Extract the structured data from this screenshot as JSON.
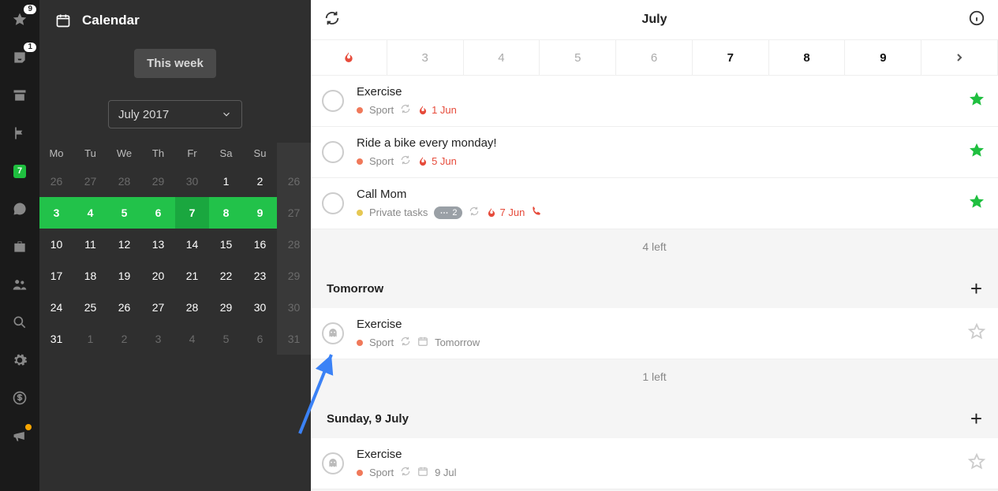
{
  "rail": {
    "star_badge": "9",
    "inbox_badge": "1",
    "today_date": "7"
  },
  "side": {
    "title": "Calendar",
    "this_week": "This week",
    "month_label": "July 2017",
    "weekdays": [
      "Mo",
      "Tu",
      "We",
      "Th",
      "Fr",
      "Sa",
      "Su"
    ],
    "grid": [
      [
        "26",
        "27",
        "28",
        "29",
        "30",
        "1",
        "2",
        "26"
      ],
      [
        "3",
        "4",
        "5",
        "6",
        "7",
        "8",
        "9",
        "27"
      ],
      [
        "10",
        "11",
        "12",
        "13",
        "14",
        "15",
        "16",
        "28"
      ],
      [
        "17",
        "18",
        "19",
        "20",
        "21",
        "22",
        "23",
        "29"
      ],
      [
        "24",
        "25",
        "26",
        "27",
        "28",
        "29",
        "30",
        "30"
      ],
      [
        "31",
        "1",
        "2",
        "3",
        "4",
        "5",
        "6",
        "31"
      ]
    ]
  },
  "top": {
    "month": "July"
  },
  "strip": {
    "days": [
      "3",
      "4",
      "5",
      "6",
      "7",
      "8",
      "9"
    ]
  },
  "sections": [
    {
      "tasks": [
        {
          "title": "Exercise",
          "category": "Sport",
          "cat_color": "sport",
          "repeat": true,
          "overdue": "1 Jun",
          "starred": true
        },
        {
          "title": "Ride a bike every monday!",
          "category": "Sport",
          "cat_color": "sport",
          "repeat": true,
          "overdue": "5 Jun",
          "starred": true
        },
        {
          "title": "Call Mom",
          "category": "Private tasks",
          "cat_color": "private",
          "repeat": true,
          "overdue": "7 Jun",
          "comments": "2",
          "phone": true,
          "starred": true
        }
      ],
      "footer": "4 left"
    },
    {
      "header": "Tomorrow",
      "tasks": [
        {
          "title": "Exercise",
          "category": "Sport",
          "cat_color": "sport",
          "repeat": true,
          "date_label": "Tomorrow",
          "ghost": true,
          "starred": false
        }
      ],
      "footer": "1 left"
    },
    {
      "header": "Sunday, 9 July",
      "tasks": [
        {
          "title": "Exercise",
          "category": "Sport",
          "cat_color": "sport",
          "repeat": true,
          "date_label": "9 Jul",
          "ghost": true,
          "starred": false
        }
      ]
    }
  ]
}
